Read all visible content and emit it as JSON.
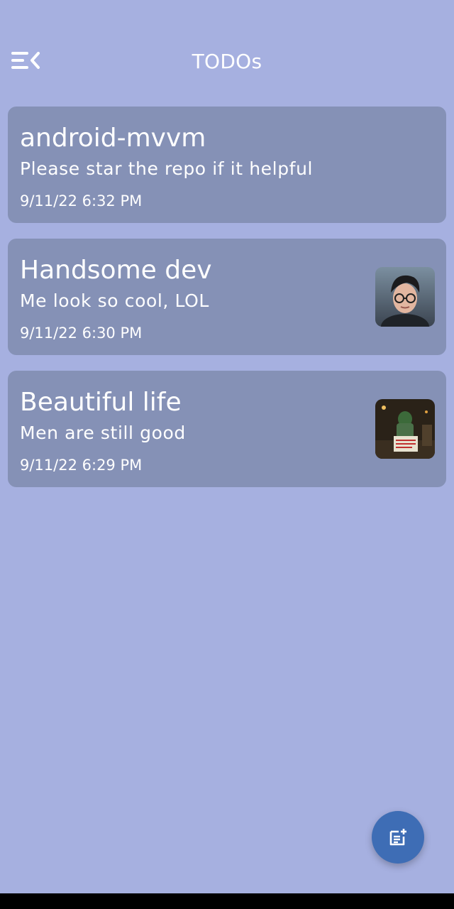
{
  "app": {
    "title": "TODOs",
    "colors": {
      "background": "#a6b0e0",
      "card": "#8591b6",
      "fab": "#3e6db5",
      "text": "#ffffff"
    }
  },
  "header": {
    "menu_icon": "menu-collapse-icon"
  },
  "todos": [
    {
      "title": "android-mvvm",
      "description": "Please star the repo if it helpful",
      "date": "9/11/22 6:32 PM"
    },
    {
      "title": "Handsome dev",
      "description": "Me look so cool, LOL",
      "date": "9/11/22 6:30 PM",
      "image": "avatar-photo"
    },
    {
      "title": "Beautiful life",
      "description": "Men are still good",
      "date": "9/11/22 6:29 PM",
      "image": "street-photo"
    }
  ],
  "fab": {
    "icon": "add-note-icon"
  }
}
